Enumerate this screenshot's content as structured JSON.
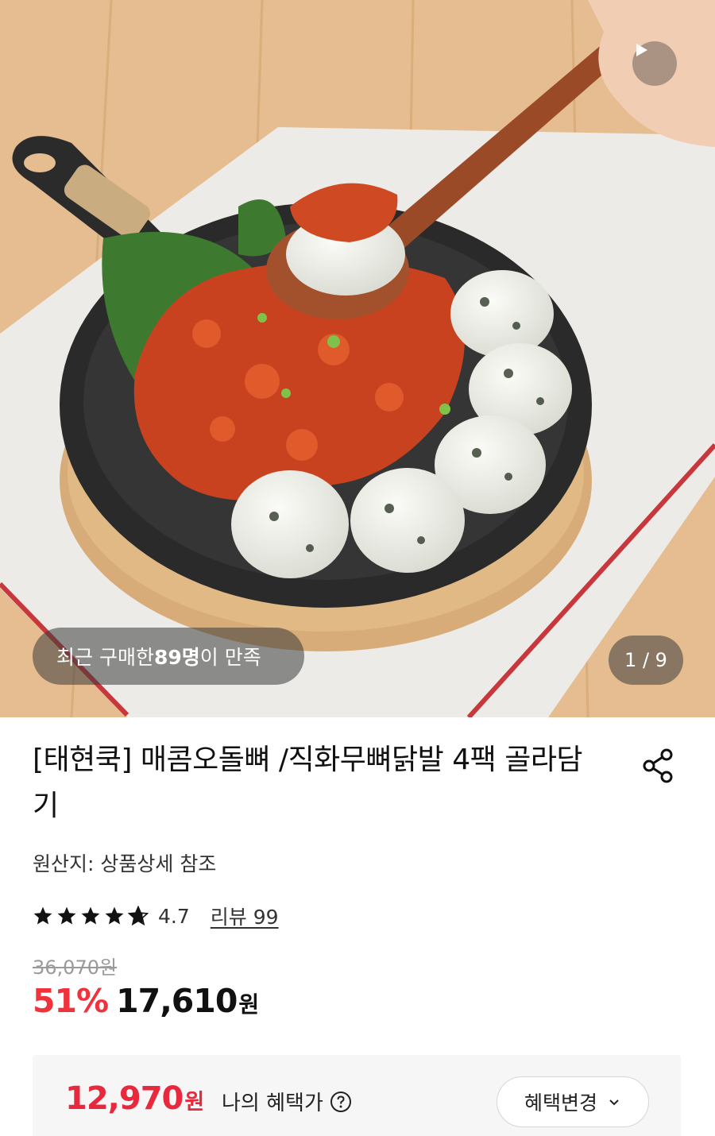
{
  "gallery": {
    "recent_prefix": "최근 구매한 ",
    "recent_count": "89명",
    "recent_suffix": "이 만족",
    "counter": "1 / 9",
    "video_icon": "play-icon"
  },
  "product": {
    "title": "[태현쿡] 매콤오돌뼈 /직화무뼈닭발 4팩 골라담기",
    "origin": "원산지: 상품상세 참조",
    "rating": 4.7,
    "rating_text": "4.7",
    "review_link": "리뷰 99",
    "original_price": "36,070원",
    "discount": "51%",
    "sale_price": "17,610",
    "sale_currency": "원",
    "share_icon": "share-icon"
  },
  "benefit": {
    "amount": "12,970",
    "currency": "원",
    "label": "나의 혜택가",
    "change_button": "혜택변경"
  },
  "colors": {
    "discount_red": "#f0323c",
    "benefit_red": "#e8283c",
    "text": "#111111",
    "muted": "#9a9a9a"
  }
}
